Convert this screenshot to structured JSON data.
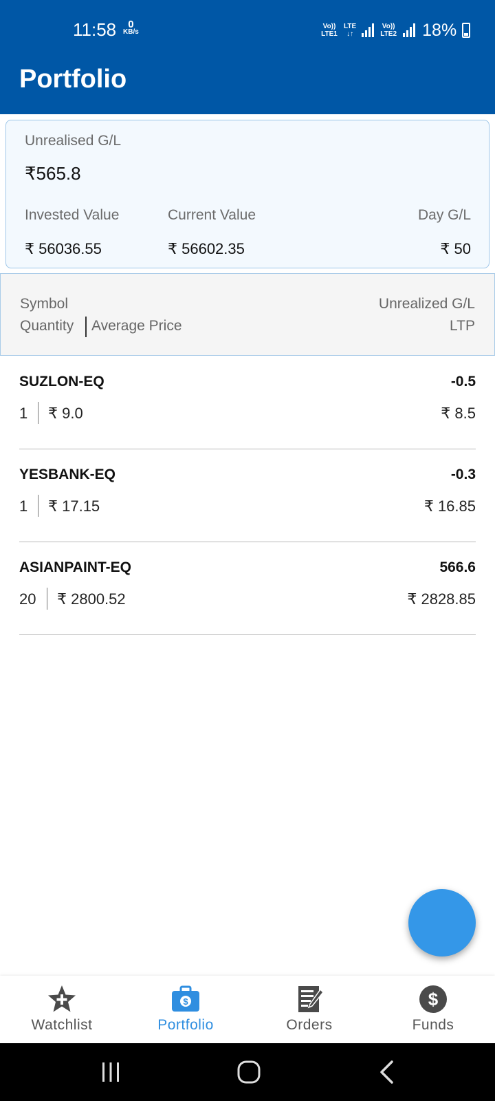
{
  "status": {
    "time": "11:58",
    "speed_value": "0",
    "speed_unit": "KB/s",
    "sim1": "Vo)) LTE1",
    "lte": "LTE",
    "sim2": "Vo)) LTE2",
    "battery": "18%"
  },
  "header": {
    "title": "Portfolio"
  },
  "summary": {
    "unrealised_label": "Unrealised G/L",
    "unrealised_value": "₹565.8",
    "invested_label": "Invested Value",
    "invested_value": "₹ 56036.55",
    "current_label": "Current Value",
    "current_value": "₹ 56602.35",
    "day_label": "Day G/L",
    "day_value": "₹ 50"
  },
  "table_header": {
    "symbol": "Symbol",
    "quantity": "Quantity",
    "avg_price": "Average Price",
    "unrealized": "Unrealized G/L",
    "ltp": "LTP"
  },
  "holdings": [
    {
      "symbol": "SUZLON-EQ",
      "gl": "-0.5",
      "qty": "1",
      "avg": "₹ 9.0",
      "ltp": "₹ 8.5"
    },
    {
      "symbol": "YESBANK-EQ",
      "gl": "-0.3",
      "qty": "1",
      "avg": "₹ 17.15",
      "ltp": "₹ 16.85"
    },
    {
      "symbol": "ASIANPAINT-EQ",
      "gl": "566.6",
      "qty": "20",
      "avg": "₹ 2800.52",
      "ltp": "₹ 2828.85"
    }
  ],
  "nav": [
    {
      "label": "Watchlist",
      "icon": "star-plus-icon",
      "active": false
    },
    {
      "label": "Portfolio",
      "icon": "briefcase-dollar-icon",
      "active": true
    },
    {
      "label": "Orders",
      "icon": "document-edit-icon",
      "active": false
    },
    {
      "label": "Funds",
      "icon": "dollar-circle-icon",
      "active": false
    }
  ],
  "colors": {
    "primary": "#0057a6",
    "accent": "#3497e8",
    "active_nav": "#2f8ee0"
  }
}
